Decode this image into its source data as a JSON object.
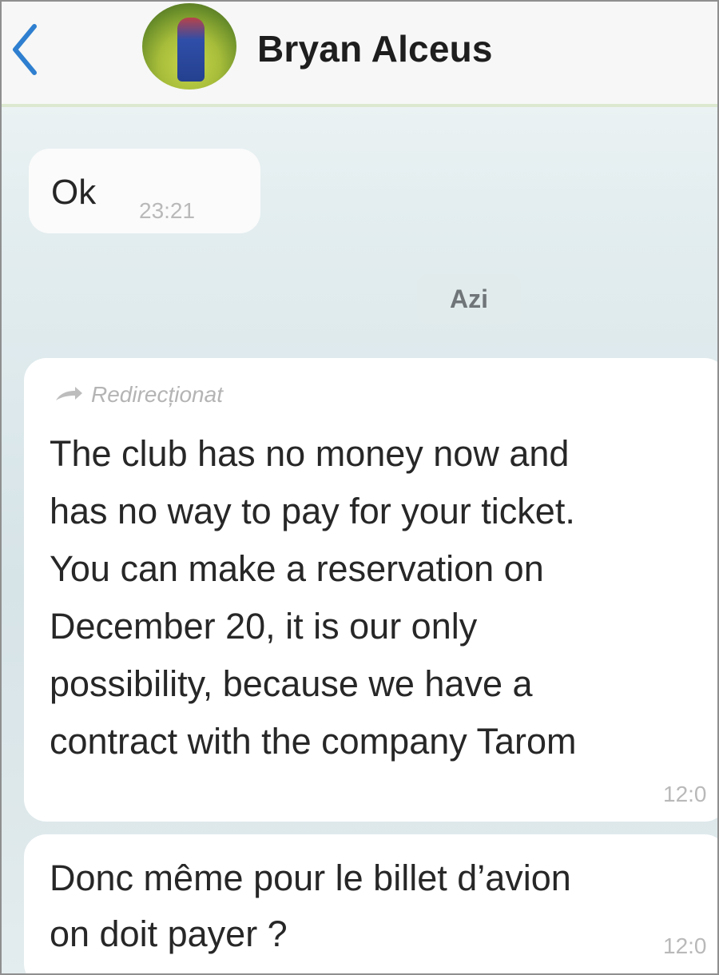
{
  "header": {
    "contact_name": "Bryan Alceus",
    "back_icon": "chevron-left-icon",
    "accent_color": "#2f7fd0"
  },
  "messages": [
    {
      "text": "Ok",
      "time": "23:21"
    },
    {
      "day_label": "Azi"
    },
    {
      "forwarded_label": "Redirecționat",
      "forward_icon": "forward-arrow-icon",
      "lines": [
        "The club has no money now and",
        "has no way to pay for your ticket.",
        "You can make a reservation on",
        "December 20, it is our only",
        "possibility, because we have a",
        "contract with the company Tarom"
      ],
      "time": "12:0"
    },
    {
      "lines": [
        "Donc même pour le billet d’avion",
        "on doit payer ?"
      ],
      "time": "12:0"
    }
  ]
}
